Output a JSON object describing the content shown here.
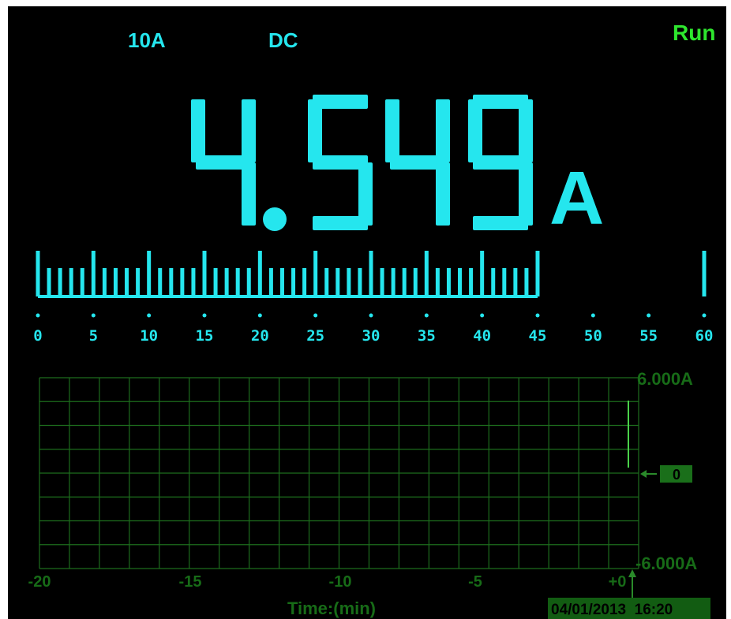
{
  "header": {
    "range": "10A",
    "coupling": "DC",
    "status": "Run"
  },
  "reading": {
    "value": "4.549",
    "digits": [
      "4",
      "5",
      "4",
      "9"
    ],
    "unit": "A"
  },
  "bargraph": {
    "scale_labels": [
      "0",
      "5",
      "10",
      "15",
      "20",
      "25",
      "30",
      "35",
      "40",
      "45",
      "50",
      "55",
      "60"
    ],
    "scale_max": 60,
    "level": 45
  },
  "trend": {
    "y_max_label": "6.000A",
    "y_min_label": "-6.000A",
    "zero_marker_label": "0",
    "x_tick_labels": [
      "-20",
      "-15",
      "-10",
      "-5",
      "+0"
    ],
    "x_axis_label": "Time:(min)",
    "datetime": "04/01/2013  16:20"
  },
  "colors": {
    "background": "#000000",
    "reading": "#25e6ee",
    "status": "#2ee62e",
    "grid": "#1d6d1d"
  }
}
